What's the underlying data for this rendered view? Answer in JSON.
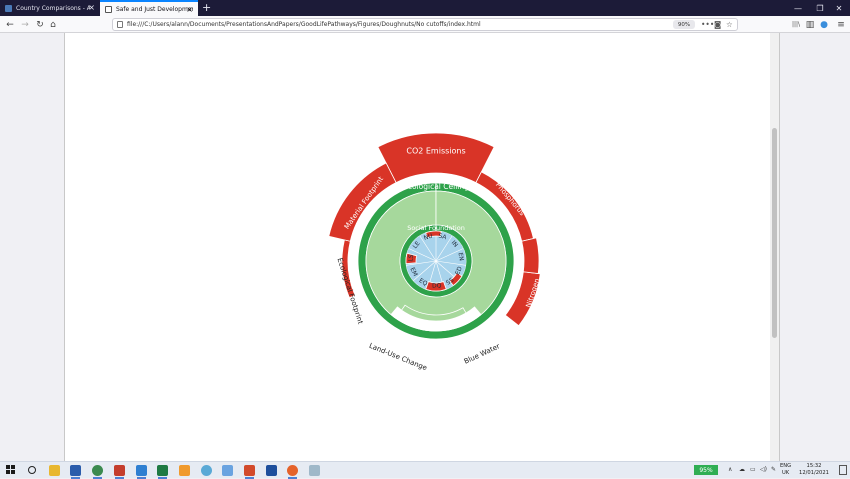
{
  "browser": {
    "tabs": [
      {
        "title": "Country Comparisons - A Good"
      },
      {
        "title": "Safe and Just Development Space"
      }
    ],
    "new_tab_glyph": "+",
    "window_controls": {
      "minimize": "—",
      "restore": "❐",
      "close": "✕"
    },
    "nav": {
      "back": "←",
      "forward": "→",
      "reload": "↻",
      "home": "⌂"
    },
    "url": "file:///C:/Users/alann/Documents/PresentationsAndPapers/GoodLifePathways/Figures/Doughnuts/No cutoffs/index.html",
    "zoom": "90%",
    "url_actions": {
      "more": "•••",
      "pocket": "◙",
      "bookmark": "☆"
    },
    "toolbar_right": {
      "library": "|||\\",
      "sidebar": "▥",
      "account": "●",
      "menu": "≡"
    }
  },
  "doughnut": {
    "outer_labels": [
      "CO2 Emissions",
      "Phosphorus",
      "Nitrogen",
      "Blue Water",
      "Land-Use Change",
      "Ecological Footprint",
      "Material Footprint"
    ],
    "ceiling_label": "Ecological Ceiling",
    "foundation_label": "Social Foundation",
    "inner_labels": [
      "NU",
      "SA",
      "IN",
      "EN",
      "ED",
      "SS",
      "DQ",
      "EQ",
      "EM",
      "LS",
      "LE"
    ],
    "colors": {
      "overshoot": "#d93427",
      "ring_dark": "#2ea24a",
      "ring_light": "#a6d89c",
      "center": "#a8d3ec",
      "spokes": "#ffffff"
    }
  },
  "taskbar": {
    "battery": "95%",
    "language": {
      "line1": "ENG",
      "line2": "UK"
    },
    "clock": {
      "time": "15:32",
      "date": "12/01/2021"
    },
    "tray_icons": [
      "chevron-up-icon",
      "cloud-icon",
      "network-icon",
      "volume-icon",
      "pen-icon"
    ],
    "apps": [
      "search",
      "file-explorer",
      "word",
      "chrome",
      "acrobat",
      "vscode",
      "excel",
      "sublime",
      "firefox-nightly",
      "mail",
      "powerpoint",
      "azure",
      "firefox",
      "paint"
    ]
  }
}
